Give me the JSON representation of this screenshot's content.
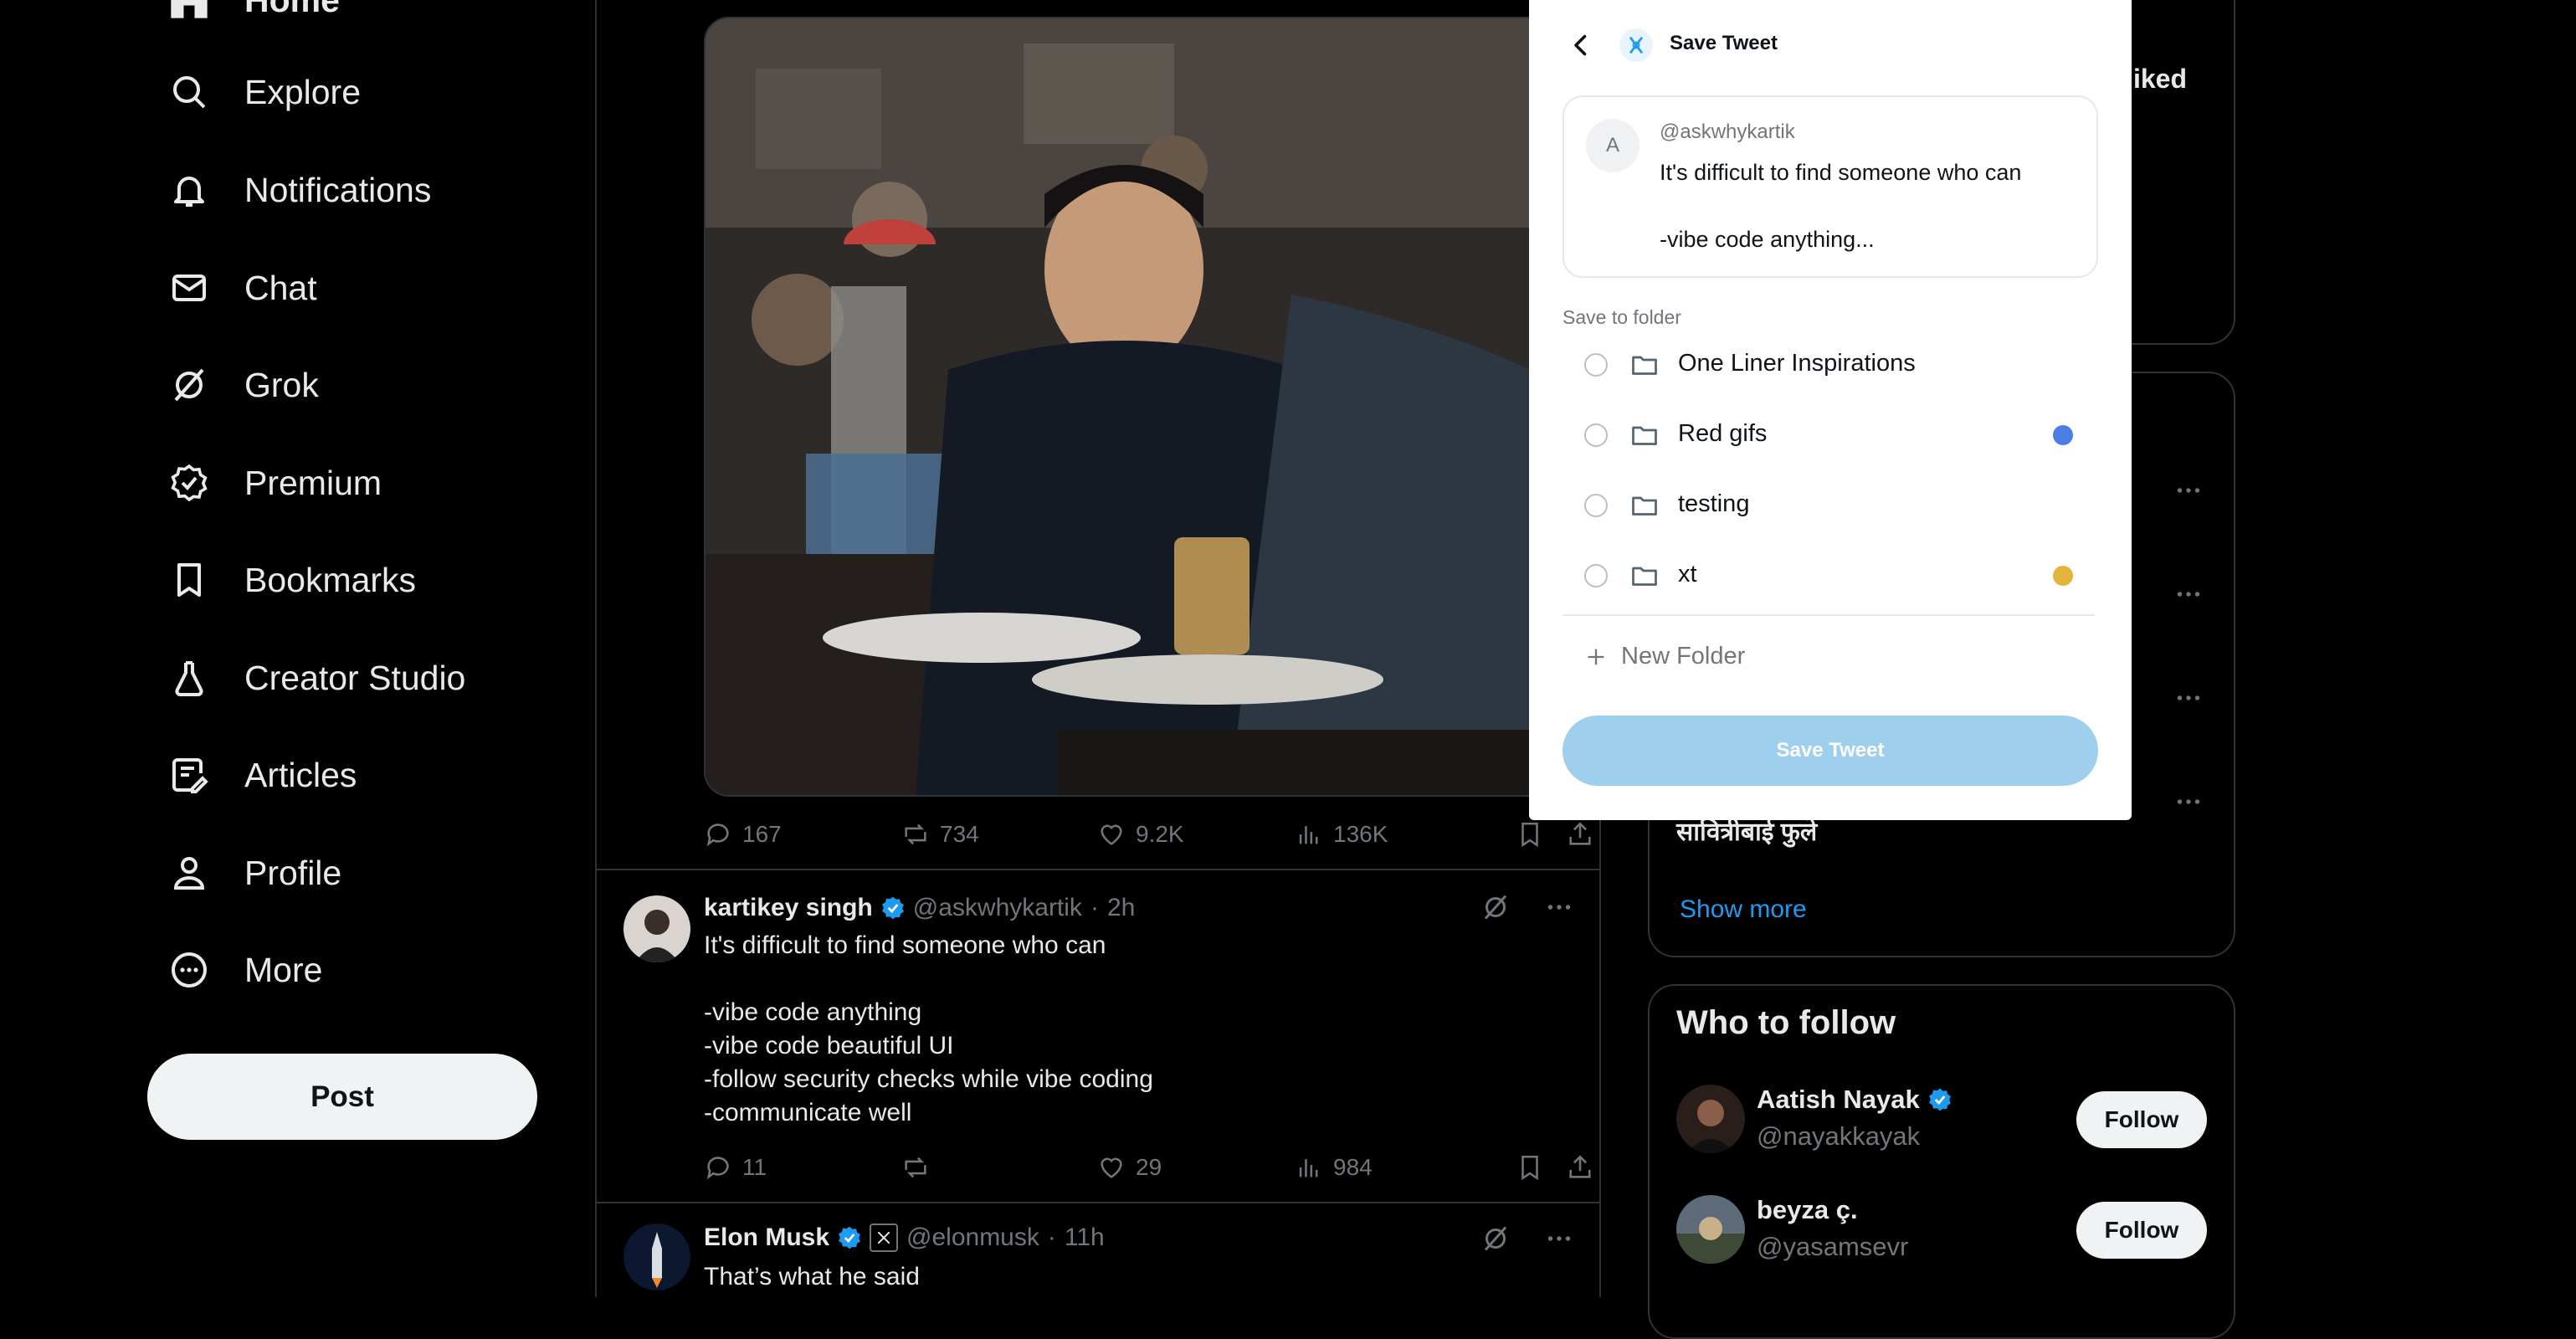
{
  "nav": {
    "items": [
      {
        "label": "Home",
        "icon": "home-icon"
      },
      {
        "label": "Explore",
        "icon": "search-icon"
      },
      {
        "label": "Notifications",
        "icon": "bell-icon"
      },
      {
        "label": "Chat",
        "icon": "mail-icon"
      },
      {
        "label": "Grok",
        "icon": "grok-icon"
      },
      {
        "label": "Premium",
        "icon": "premium-icon"
      },
      {
        "label": "Bookmarks",
        "icon": "bookmark-icon"
      },
      {
        "label": "Creator Studio",
        "icon": "flask-icon"
      },
      {
        "label": "Articles",
        "icon": "article-icon"
      },
      {
        "label": "Profile",
        "icon": "person-icon"
      },
      {
        "label": "More",
        "icon": "more-circle-icon"
      }
    ],
    "post_label": "Post"
  },
  "feed": {
    "media_post": {
      "replies": "167",
      "reposts": "734",
      "likes": "9.2K",
      "views": "136K"
    },
    "tweets": [
      {
        "name": "kartikey singh",
        "handle": "@askwhykartik",
        "time": "2h",
        "text": "It's difficult to find someone who can\n\n-vibe code anything\n-vibe code beautiful UI\n-follow security checks while vibe coding\n-communicate well",
        "replies": "11",
        "reposts": "",
        "likes": "29",
        "views": "984"
      },
      {
        "name": "Elon Musk",
        "handle": "@elonmusk",
        "time": "11h",
        "text": "That’s what he said"
      }
    ]
  },
  "sidebar": {
    "top_card_fragment": "iked",
    "trend_partial": "सावित्रीबाई फुले",
    "show_more": "Show more",
    "who_to_follow": {
      "title": "Who to follow",
      "accounts": [
        {
          "name": "Aatish Nayak",
          "handle": "@nayakkayak",
          "verified": true,
          "button": "Follow"
        },
        {
          "name": "beyza ç.",
          "handle": "@yasamsevr",
          "verified": false,
          "button": "Follow"
        }
      ]
    }
  },
  "popup": {
    "title": "Save Tweet",
    "preview": {
      "avatar_letter": "A",
      "handle": "@askwhykartik",
      "text": "It's difficult to find someone who can\n\n-vibe code anything..."
    },
    "folder_label": "Save to folder",
    "folders": [
      {
        "name": "One Liner Inspirations",
        "color": ""
      },
      {
        "name": "Red gifs",
        "color": "#4a7ee3"
      },
      {
        "name": "testing",
        "color": ""
      },
      {
        "name": "xt",
        "color": "#e3b43a"
      }
    ],
    "new_folder_label": "New Folder",
    "save_label": "Save Tweet"
  },
  "colors": {
    "accent": "#1d9bf0",
    "save_button": "#9ed0ee",
    "background": "#000000"
  }
}
